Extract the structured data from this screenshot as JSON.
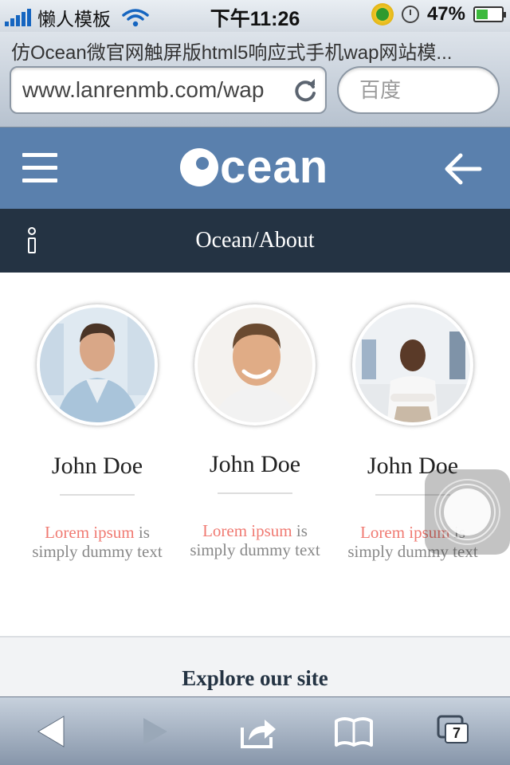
{
  "status_bar": {
    "carrier": "懒人模板",
    "time": "下午11:26",
    "battery_percent": "47%",
    "battery_level": 0.47
  },
  "browser": {
    "page_title": "仿Ocean微官网触屏版html5响应式手机wap网站模...",
    "url": "www.lanrenmb.com/wap",
    "search_placeholder": "百度"
  },
  "site": {
    "logo": "cean",
    "breadcrumb": "Ocean/About"
  },
  "team": [
    {
      "name": "John Doe",
      "highlight": "Lorem ipsum",
      "desc_rest": " is",
      "desc_line2": "simply dummy text"
    },
    {
      "name": "John Doe",
      "highlight": "Lorem ipsum",
      "desc_rest": " is",
      "desc_line2": "simply dummy text"
    },
    {
      "name": "John Doe",
      "highlight": "Lorem ipsum",
      "desc_rest": " is",
      "desc_line2": "simply dummy text"
    }
  ],
  "explore": {
    "title": "Explore our site"
  },
  "toolbar": {
    "tab_count": "7"
  },
  "colors": {
    "header": "#5a80ad",
    "breadcrumb_bar": "#243343",
    "highlight": "#f07a72",
    "muted_text": "#888888"
  }
}
